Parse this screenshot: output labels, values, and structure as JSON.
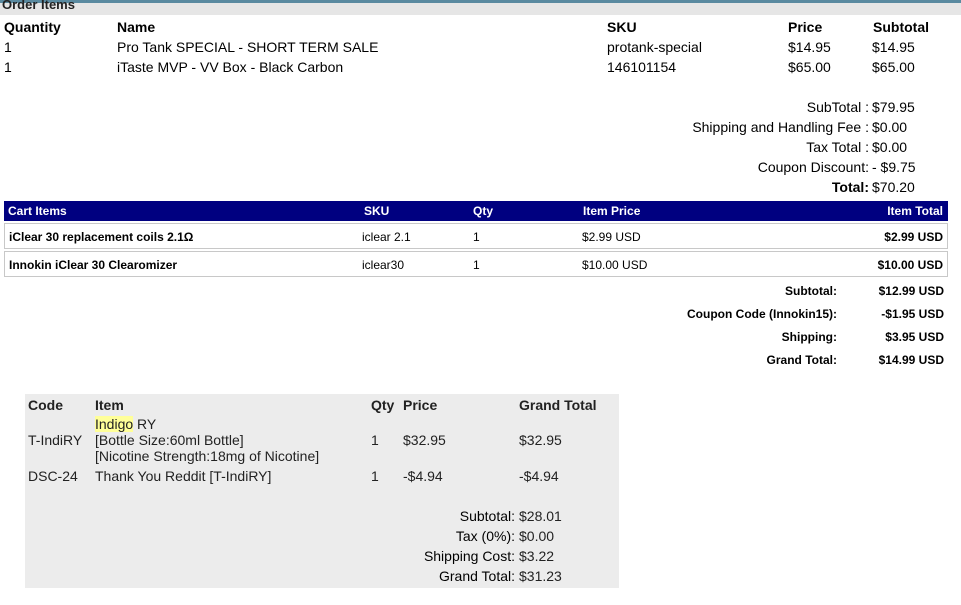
{
  "order_items": {
    "title": "Order Items",
    "headers": {
      "quantity": "Quantity",
      "name": "Name",
      "sku": "SKU",
      "price": "Price",
      "subtotal": "Subtotal"
    },
    "rows": [
      {
        "quantity": "1",
        "name": "Pro Tank SPECIAL - SHORT TERM SALE",
        "sku": "protank-special",
        "price": "$14.95",
        "subtotal": "$14.95"
      },
      {
        "quantity": "1",
        "name": "iTaste MVP - VV Box - Black Carbon",
        "sku": "146101154",
        "price": "$65.00",
        "subtotal": "$65.00"
      }
    ],
    "totals": [
      {
        "label": "SubTotal :",
        "value": "$79.95",
        "bold": false
      },
      {
        "label": "Shipping and Handling Fee :",
        "value": "$0.00",
        "bold": false
      },
      {
        "label": "Tax Total :",
        "value": "$0.00",
        "bold": false
      },
      {
        "label": "Coupon Discount:",
        "value": "- $9.75",
        "bold": false
      },
      {
        "label": "Total:",
        "value": "$70.20",
        "bold": true
      }
    ]
  },
  "cart_items": {
    "headers": {
      "items": "Cart Items",
      "sku": "SKU",
      "qty": "Qty",
      "item_price": "Item Price",
      "item_total": "Item Total"
    },
    "rows": [
      {
        "name": "iClear 30 replacement coils 2.1Ω",
        "sku": "iclear 2.1",
        "qty": "1",
        "item_price": "$2.99 USD",
        "item_total": "$2.99 USD"
      },
      {
        "name": "Innokin iClear 30 Clearomizer",
        "sku": "iclear30",
        "qty": "1",
        "item_price": "$10.00 USD",
        "item_total": "$10.00 USD"
      }
    ],
    "totals": [
      {
        "label": "Subtotal:",
        "value": "$12.99 USD"
      },
      {
        "label": "Coupon Code (Innokin15):",
        "value": "-$1.95 USD"
      },
      {
        "label": "Shipping:",
        "value": "$3.95 USD"
      },
      {
        "label": "Grand Total:",
        "value": "$14.99 USD"
      }
    ]
  },
  "code_table": {
    "headers": {
      "code": "Code",
      "item": "Item",
      "qty": "Qty",
      "price": "Price",
      "grand_total": "Grand Total"
    },
    "rows": [
      {
        "code": "T-IndiRY",
        "item_highlight": "Indigo",
        "item_rest": " RY",
        "option1": "[Bottle Size:60ml Bottle]",
        "option2": "[Nicotine Strength:18mg of Nicotine]",
        "qty": "1",
        "price": "$32.95",
        "grand_total": "$32.95"
      },
      {
        "code": "DSC-24",
        "item": "Thank You Reddit [T-IndiRY]",
        "qty": "1",
        "price": "-$4.94",
        "grand_total": "-$4.94"
      }
    ],
    "totals": [
      {
        "label": "Subtotal:",
        "value": "$28.01"
      },
      {
        "label": "Tax (0%):",
        "value": "$0.00"
      },
      {
        "label": "Shipping Cost:",
        "value": "$3.22"
      },
      {
        "label": "Grand Total:",
        "value": "$31.23"
      }
    ]
  }
}
